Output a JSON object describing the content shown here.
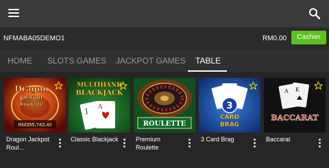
{
  "header": {
    "menu_icon": "hamburger-menu-icon",
    "search_icon": "search-icon",
    "background": "#3a3a3a"
  },
  "account": {
    "username": "NFMABA05DEMO1",
    "balance": "RM0.00",
    "cashier_label": "Cashier",
    "cashier_color": "#5cc21f"
  },
  "tabs": [
    {
      "label": "HOME",
      "active": false
    },
    {
      "label": "SLOTS GAMES",
      "active": false
    },
    {
      "label": "JACKPOT GAMES",
      "active": false
    },
    {
      "label": "TABLE",
      "active": true
    }
  ],
  "games": [
    {
      "name": "Dragon Jackpot Roul...",
      "logo_text": [
        "Dragon",
        "Jackpot",
        "Roulette"
      ],
      "jackpot": "RM355,743.40",
      "favorite_icon": "star-icon"
    },
    {
      "name": "Classic Blackjack",
      "logo_text": [
        "MULTIHAND",
        "BLACKJACK"
      ],
      "favorite_icon": "star-icon"
    },
    {
      "name": "Premium Roulette",
      "logo_text": [
        "ROULETTE"
      ]
    },
    {
      "name": "3 Card Brag",
      "logo_text": [
        "3",
        "CARD",
        "BRAG"
      ],
      "favorite_icon": "star-icon"
    },
    {
      "name": "Baccarat",
      "logo_text": [
        "BACCARAT"
      ],
      "favorite_icon": "star-icon"
    }
  ]
}
